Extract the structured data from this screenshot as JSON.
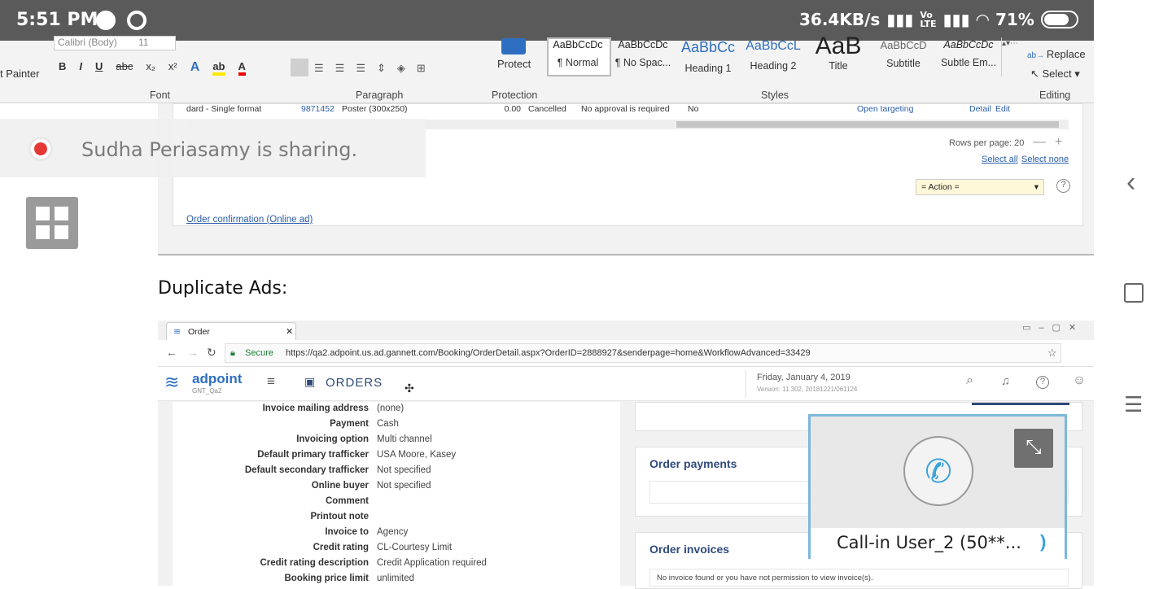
{
  "status": {
    "time": "5:51 PM",
    "speed": "36.4KB/s",
    "battery": "71%"
  },
  "ribbon": {
    "font_name": "Calibri (Body)",
    "font_size": "11",
    "painter": "t Painter",
    "font_group": "Font",
    "paragraph_group": "Paragraph",
    "protect_label": "Protect",
    "protection_group": "Protection",
    "styles_group": "Styles",
    "editing_group": "Editing",
    "replace": "Replace",
    "select": "Select",
    "styles": [
      {
        "sample": "AaBbCcDc",
        "name": "¶ Normal"
      },
      {
        "sample": "AaBbCcDc",
        "name": "¶ No Spac..."
      },
      {
        "sample": "AaBbCc",
        "name": "Heading 1"
      },
      {
        "sample": "AaBbCcL",
        "name": "Heading 2"
      },
      {
        "sample": "AaB",
        "name": "Title"
      },
      {
        "sample": "AaBbCcD",
        "name": "Subtitle"
      },
      {
        "sample": "AaBbCcDc",
        "name": "Subtle Em..."
      }
    ]
  },
  "sharing": {
    "text": "Sudha Periasamy is sharing."
  },
  "top_table": {
    "row": [
      "dard - Single format",
      "9871452",
      "Poster (300x250)",
      "0.00",
      "Cancelled",
      "No approval is required",
      "No",
      "Open targeting",
      "Detail",
      "Edit"
    ],
    "rows_per_page": "Rows per page: 20",
    "select_all": "Select all",
    "select_none": "Select none",
    "action": "= Action =",
    "order_confirm": "Order confirmation (Online ad)"
  },
  "heading": "Duplicate Ads:",
  "browser": {
    "tab": "Order",
    "secure": "Secure",
    "url": "https://qa2.adpoint.us.ad.gannett.com/Booking/OrderDetail.aspx?OrderID=2888927&senderpage=home&WorkflowAdvanced=33429",
    "logo": "adpoint",
    "logo_sub": "GNT_Qa2",
    "section": "ORDERS",
    "date": "Friday, January 4, 2019",
    "version": "Version: 11.302, 20181221/061124",
    "fields": [
      {
        "label": "Invoice mailing address",
        "value": "(none)"
      },
      {
        "label": "Payment",
        "value": "Cash"
      },
      {
        "label": "Invoicing option",
        "value": "Multi channel"
      },
      {
        "label": "Default primary trafficker",
        "value": "USA Moore, Kasey"
      },
      {
        "label": "Default secondary trafficker",
        "value": "Not specified"
      },
      {
        "label": "Online buyer",
        "value": "Not specified"
      },
      {
        "label": "Comment",
        "value": ""
      },
      {
        "label": "Printout note",
        "value": ""
      },
      {
        "label": "Invoice to",
        "value": "Agency"
      },
      {
        "label": "Credit rating",
        "value": "CL-Courtesy Limit"
      },
      {
        "label": "Credit rating description",
        "value": "Credit Application required"
      },
      {
        "label": "Booking price limit",
        "value": "unlimited"
      }
    ],
    "order_payments": "Order payments",
    "order_invoices": "Order invoices",
    "no_invoice": "No invoice found or you have not permission to view invoice(s)."
  },
  "call": {
    "name": "Call-in User_2 (50**..."
  }
}
